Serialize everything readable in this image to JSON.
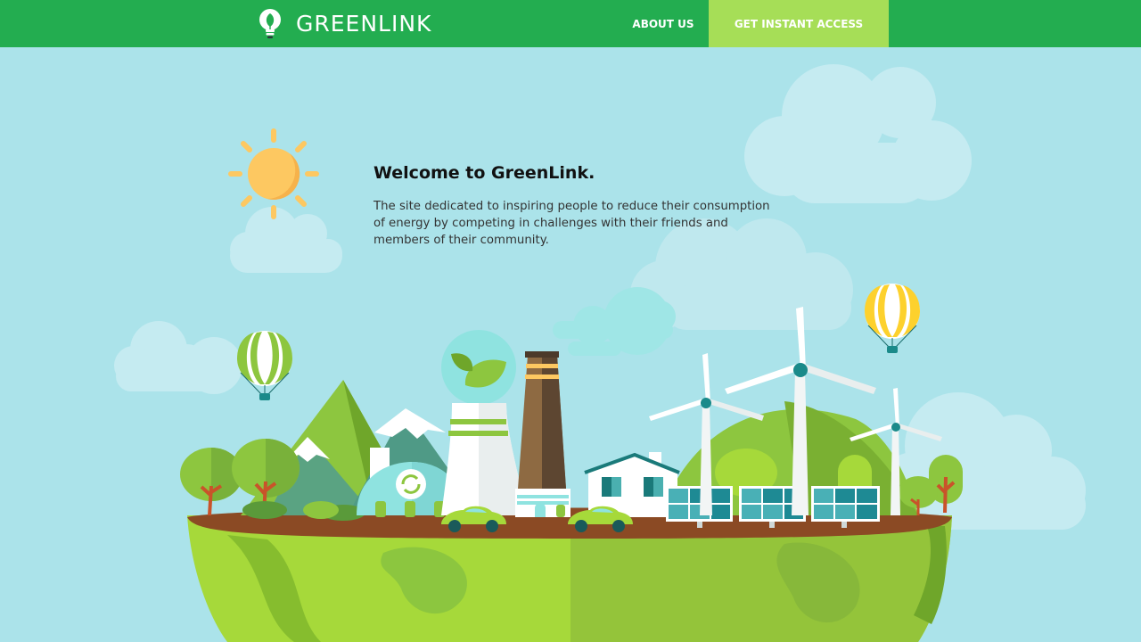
{
  "header": {
    "brand_name": "GREENLINK",
    "nav_about": "ABOUT US",
    "nav_cta": "GET INSTANT ACCESS"
  },
  "hero": {
    "title": "Welcome to GreenLink.",
    "description": "The site dedicated to inspiring people to reduce their consumption of energy by competing in challenges with their friends and members of their community."
  },
  "colors": {
    "nav_bg": "#23ad50",
    "cta_bg": "#a6de57",
    "sky": "#abe3ea",
    "sun": "#fdc861",
    "ground": "#8dc63f",
    "soil": "#8b4a24"
  },
  "icons": [
    "lightbulb-leaf-icon"
  ]
}
